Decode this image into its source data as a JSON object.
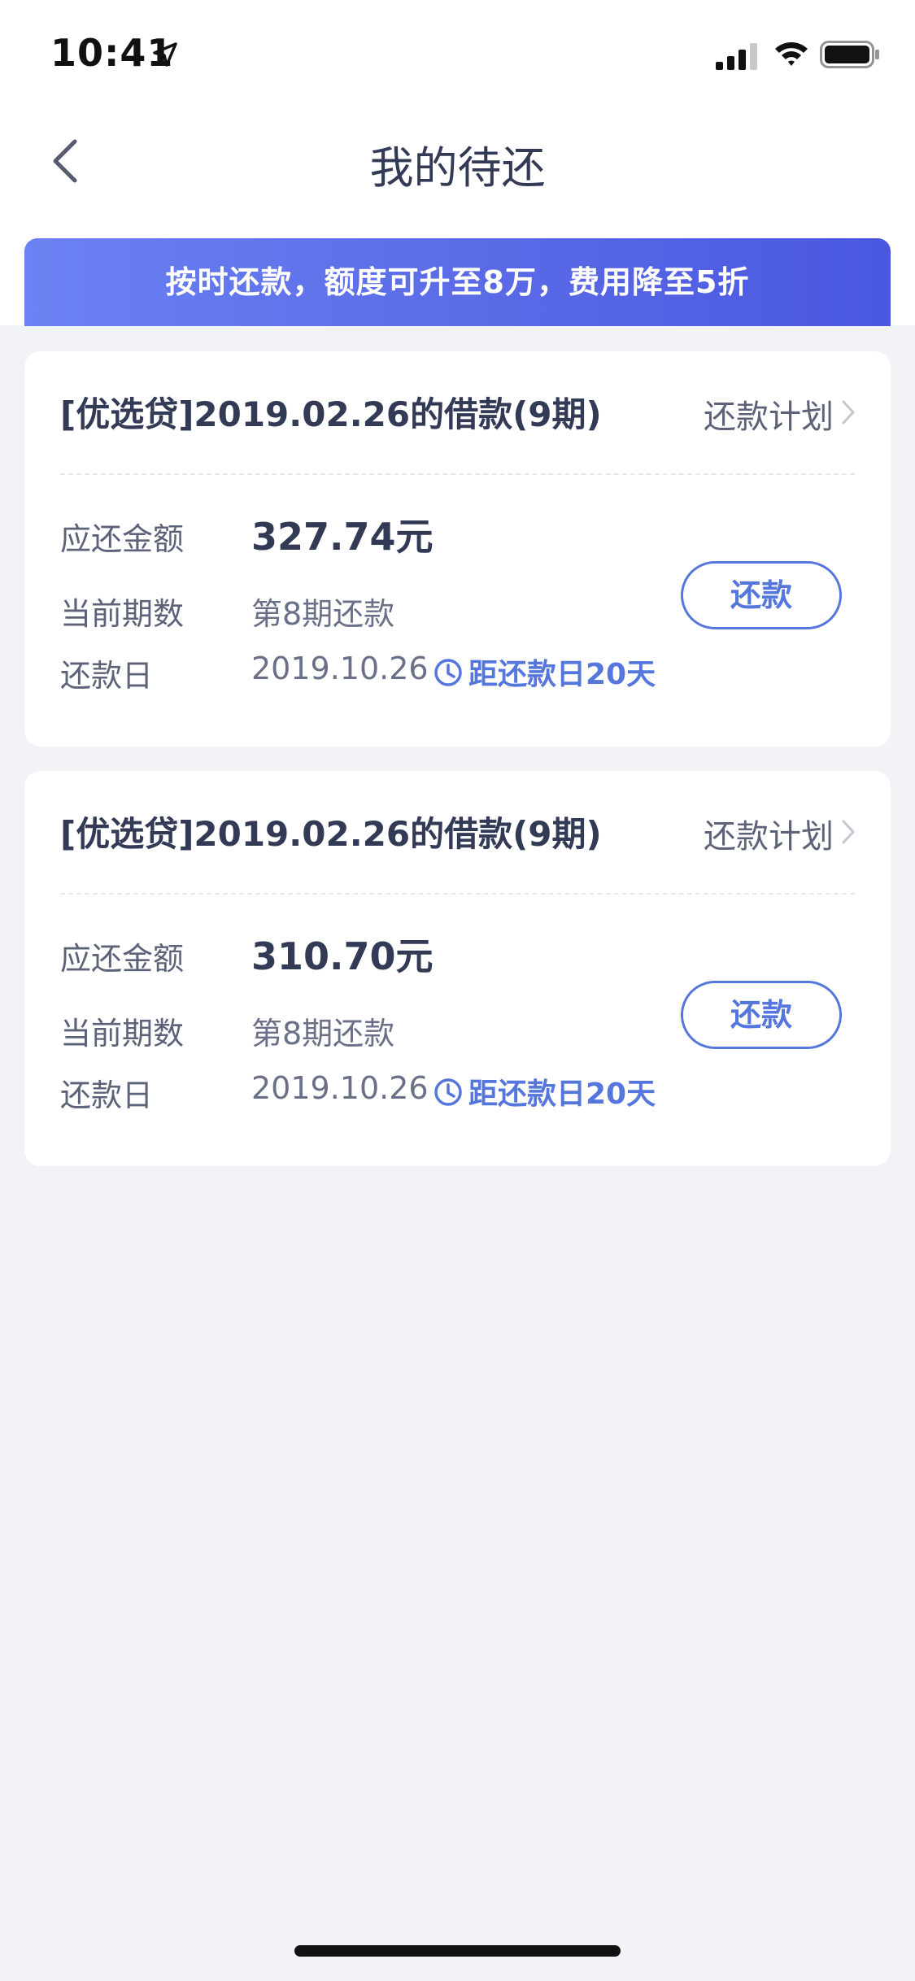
{
  "status_bar": {
    "time": "10:41"
  },
  "nav": {
    "title": "我的待还"
  },
  "banner": {
    "text": "按时还款，额度可升至8万，费用降至5折",
    "colors": [
      "#6b82f3",
      "#4a57e0"
    ]
  },
  "loans": [
    {
      "title": "[优选贷]2019.02.26的借款(9期)",
      "plan_label": "还款计划",
      "amount_label": "应还金额",
      "amount": "327.74元",
      "period_label": "当前期数",
      "period": "第8期还款",
      "date_label": "还款日",
      "date": "2019.10.26",
      "countdown": "距还款日20天",
      "button_label": "还款"
    },
    {
      "title": "[优选贷]2019.02.26的借款(9期)",
      "plan_label": "还款计划",
      "amount_label": "应还金额",
      "amount": "310.70元",
      "period_label": "当前期数",
      "period": "第8期还款",
      "date_label": "还款日",
      "date": "2019.10.26",
      "countdown": "距还款日20天",
      "button_label": "还款"
    }
  ],
  "theme": {
    "accent": "#5577dd",
    "background": "#f2f3f7",
    "text_primary": "#333a55"
  }
}
